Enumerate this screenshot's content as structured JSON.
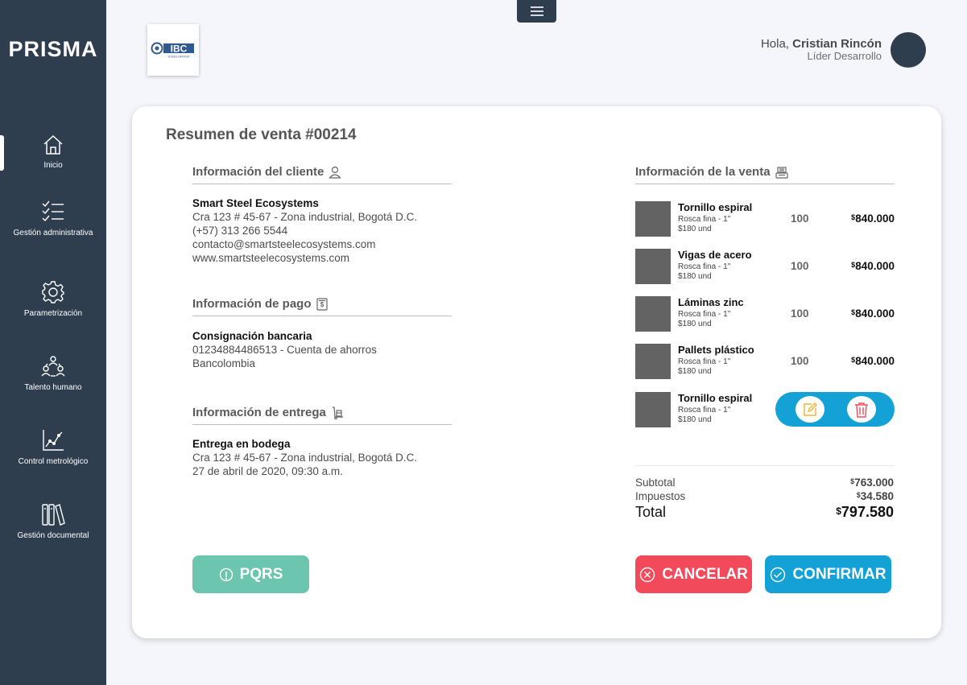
{
  "brand": "PRISMA",
  "sidebar": {
    "items": [
      {
        "label": "Inicio",
        "icon": "home-icon"
      },
      {
        "label": "Gestión administrativa",
        "icon": "checklist-icon"
      },
      {
        "label": "Parametrización",
        "icon": "gear-icon"
      },
      {
        "label": "Talento humano",
        "icon": "people-icon"
      },
      {
        "label": "Control metrológico",
        "icon": "chart-icon"
      },
      {
        "label": "Gestión documental",
        "icon": "books-icon"
      }
    ]
  },
  "header": {
    "logo_text": "IBC",
    "logo_subtext": "STEELGROUP",
    "greeting": "Hola,",
    "user_name": "Cristian Rincón",
    "user_role": "Líder Desarrollo"
  },
  "title": "Resumen de venta #00214",
  "client": {
    "heading": "Información del cliente",
    "name": "Smart Steel Ecosystems",
    "address": "Cra 123 # 45-67 - Zona industrial, Bogotá D.C.",
    "phone": "(+57) 313 266 5544",
    "email": "contacto@smartsteelecosystems.com",
    "web": "www.smartsteelecosystems.com"
  },
  "payment": {
    "heading": "Información de pago",
    "method": "Consignación bancaria",
    "account": "01234884486513 - Cuenta de ahorros",
    "bank": "Bancolombia"
  },
  "delivery": {
    "heading": "Información de entrega",
    "method": "Entrega en bodega",
    "address": "Cra 123 # 45-67 - Zona industrial, Bogotá D.C.",
    "date": "27 de abril de 2020, 09:30 a.m."
  },
  "sale": {
    "heading": "Información de la venta",
    "currency_symbol": "$",
    "items": [
      {
        "name": "Tornillo espiral",
        "desc": "Rosca fina - 1\"",
        "unit": "$180 und",
        "qty": "100",
        "price": "840.000"
      },
      {
        "name": "Vigas de acero",
        "desc": "Rosca fina - 1\"",
        "unit": "$180 und",
        "qty": "100",
        "price": "840.000"
      },
      {
        "name": "Láminas zinc",
        "desc": "Rosca fina - 1\"",
        "unit": "$180 und",
        "qty": "100",
        "price": "840.000"
      },
      {
        "name": "Pallets plástico",
        "desc": "Rosca fina - 1\"",
        "unit": "$180 und",
        "qty": "100",
        "price": "840.000"
      },
      {
        "name": "Tornillo espiral",
        "desc": "Rosca fina - 1\"",
        "unit": "$180 und"
      }
    ],
    "subtotal_label": "Subtotal",
    "subtotal": "763.000",
    "tax_label": "Impuestos",
    "tax": "34.580",
    "total_label": "Total",
    "total": "797.580"
  },
  "buttons": {
    "pqrs": "PQRS",
    "cancel": "CANCELAR",
    "confirm": "CONFIRMAR"
  },
  "colors": {
    "sidebar": "#2e3e4e",
    "pqrs": "#6cc5ae",
    "cancel": "#f24a5b",
    "confirm": "#14a2d6",
    "edit": "#f2b233",
    "delete": "#f24a5b"
  }
}
